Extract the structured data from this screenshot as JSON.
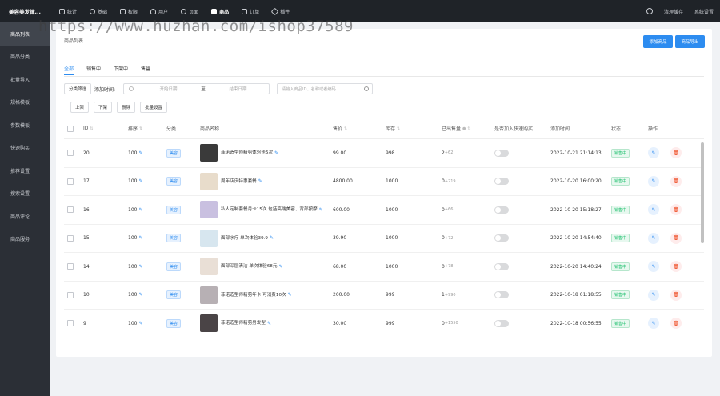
{
  "brand": "美容美发律...",
  "topnav": [
    {
      "label": "统计",
      "icon": "chart-icon"
    },
    {
      "label": "基础",
      "icon": "settings-icon"
    },
    {
      "label": "权限",
      "icon": "permission-icon"
    },
    {
      "label": "用户",
      "icon": "user-icon"
    },
    {
      "label": "页面",
      "icon": "page-icon"
    },
    {
      "label": "商品",
      "icon": "goods-icon",
      "active": true
    },
    {
      "label": "订单",
      "icon": "order-icon"
    },
    {
      "label": "插件",
      "icon": "plugin-icon"
    }
  ],
  "topright": {
    "clear_cache": "清理缓存",
    "system_settings": "系统设置"
  },
  "sidebar": [
    {
      "label": "商品列表",
      "active": true
    },
    {
      "label": "商品分类"
    },
    {
      "label": "批量导入"
    },
    {
      "label": "规格模板"
    },
    {
      "label": "参数模板"
    },
    {
      "label": "快速购买"
    },
    {
      "label": "推荐设置"
    },
    {
      "label": "搜索设置"
    },
    {
      "label": "商品评论"
    },
    {
      "label": "商品服务"
    }
  ],
  "page": {
    "title": "商品列表",
    "add_button": "添加商品",
    "export_button": "商品导出"
  },
  "tabs": [
    "全部",
    "销售中",
    "下架中",
    "售罄"
  ],
  "filter": {
    "category_filter": "分类筛选",
    "add_time_label": "添加时间:",
    "start_date": "开始日期",
    "separator": "至",
    "end_date": "结束日期",
    "search_placeholder": "请输入商品ID、名称或者编码"
  },
  "bulk": [
    "上架",
    "下架",
    "删除",
    "批量设置"
  ],
  "columns": [
    "ID",
    "排序",
    "分类",
    "商品名称",
    "售价",
    "库存",
    "已出售量",
    "是否加入快速购买",
    "添加时间",
    "状态",
    "操作"
  ],
  "rows": [
    {
      "id": "20",
      "sort": "100",
      "cat": "美容",
      "name": "菲诺造型师精剪体验卡5次",
      "price": "99.00",
      "stock": "998",
      "sold": "2",
      "sold_add": "+62",
      "time": "2022-10-21 21:14:13",
      "status": "销售中",
      "thumb": "#3a3a3a"
    },
    {
      "id": "17",
      "sort": "100",
      "cat": "美容",
      "name": "周年店庆特惠套餐",
      "price": "4800.00",
      "stock": "1000",
      "sold": "0",
      "sold_add": "+219",
      "time": "2022-10-20 16:00:20",
      "status": "销售中",
      "thumb": "#e8dccb"
    },
    {
      "id": "16",
      "sort": "100",
      "cat": "美容",
      "name": "私人定制套餐月卡15次 包括高端美容、背部按摩",
      "price": "600.00",
      "stock": "1000",
      "sold": "0",
      "sold_add": "+66",
      "time": "2022-10-20 15:18:27",
      "status": "销售中",
      "thumb": "#c9c0e0"
    },
    {
      "id": "15",
      "sort": "100",
      "cat": "美容",
      "name": "面部水疗 单次体验39.9",
      "price": "39.90",
      "stock": "1000",
      "sold": "0",
      "sold_add": "+72",
      "time": "2022-10-20 14:54:40",
      "status": "销售中",
      "thumb": "#d7e6ef"
    },
    {
      "id": "14",
      "sort": "100",
      "cat": "美容",
      "name": "面部深层清洁 单次体验68元",
      "price": "68.00",
      "stock": "1000",
      "sold": "0",
      "sold_add": "+78",
      "time": "2022-10-20 14:40:24",
      "status": "销售中",
      "thumb": "#e9dfd6"
    },
    {
      "id": "10",
      "sort": "100",
      "cat": "美容",
      "name": "菲诺造型师精剪年卡 可消费10次",
      "price": "200.00",
      "stock": "999",
      "sold": "1",
      "sold_add": "+990",
      "time": "2022-10-18 01:18:55",
      "status": "销售中",
      "thumb": "#b7b0b4"
    },
    {
      "id": "9",
      "sort": "100",
      "cat": "美容",
      "name": "菲诺造型师精剪男发型",
      "price": "30.00",
      "stock": "999",
      "sold": "0",
      "sold_add": "+1550",
      "time": "2022-10-18 00:56:55",
      "status": "销售中",
      "thumb": "#4a4446"
    }
  ],
  "watermark": "https://www.huzhan.com/ishop37589"
}
